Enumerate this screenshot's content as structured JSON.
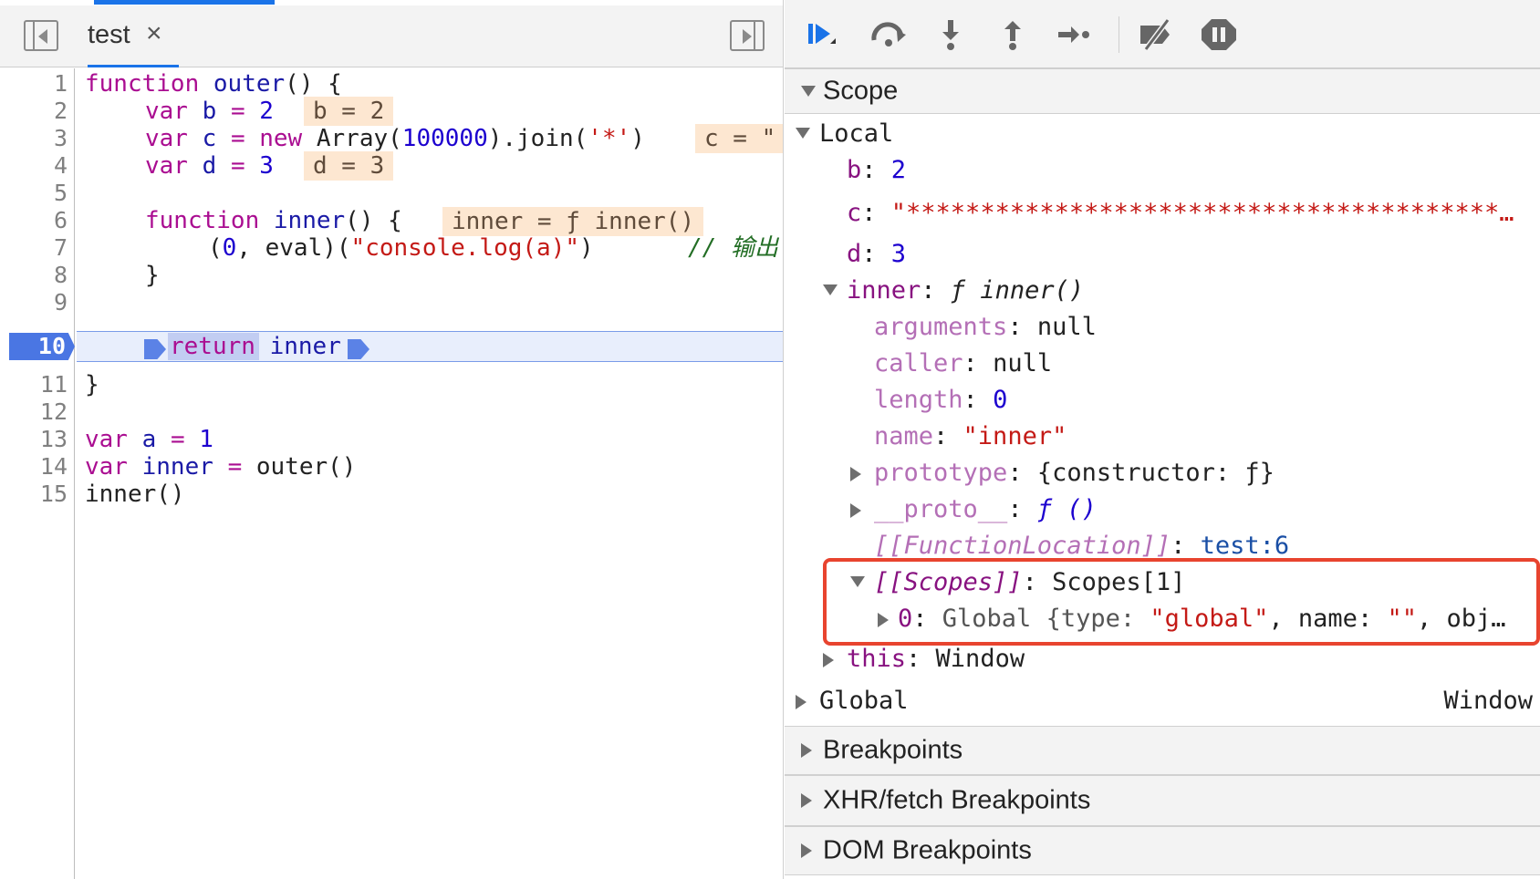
{
  "tab": {
    "file_name": "test",
    "close_glyph": "×"
  },
  "gutter": {
    "line_numbers": [
      "1",
      "2",
      "3",
      "4",
      "5",
      "6",
      "7",
      "8",
      "9",
      "10",
      "11",
      "12",
      "13",
      "14",
      "15"
    ],
    "paused_line": "10"
  },
  "code": {
    "l1": {
      "kw": "function",
      "name": "outer",
      "rest": "() {"
    },
    "l2": {
      "kw": "var",
      "name": "b",
      "eq": "=",
      "val": "2"
    },
    "l3": {
      "kw": "var",
      "name": "c",
      "eq": "=",
      "new": "new",
      "call": "Array(",
      "num": "100000",
      "join": ").join(",
      "str": "'*'",
      "end": ")"
    },
    "l4": {
      "kw": "var",
      "name": "d",
      "eq": "=",
      "val": "3"
    },
    "l6": {
      "kw": "function",
      "name": "inner",
      "rest": "() {"
    },
    "l7": {
      "open": "(",
      "zero": "0",
      "mid": ", eval)(",
      "str": "\"console.log(a)\"",
      "close": ")",
      "comment": "// 输出"
    },
    "l8": {
      "text": "}"
    },
    "l10": {
      "kw": "return",
      "name": "inner"
    },
    "l11": {
      "text": "}"
    },
    "l13": {
      "kw": "var",
      "name": "a",
      "eq": "=",
      "val": "1"
    },
    "l14": {
      "kw": "var",
      "name": "inner",
      "eq": "=",
      "call": "outer()"
    },
    "l15": {
      "call": "inner()"
    }
  },
  "inline_values": {
    "b": "b = 2",
    "c": "c = \"",
    "d": "d = 3",
    "inner": "inner = ƒ inner()"
  },
  "toolbar": {
    "resume": "resume-icon",
    "step_over": "step-over-icon",
    "step_into": "step-into-icon",
    "step_out": "step-out-icon",
    "step": "step-icon",
    "deactivate": "deactivate-breakpoints-icon",
    "pause_exceptions": "pause-on-exceptions-icon",
    "accent_color": "#1a73e8"
  },
  "scope": {
    "header": "Scope",
    "local_label": "Local",
    "b_key": "b",
    "b_val": "2",
    "c_key": "c",
    "c_val": "\"****************************************…",
    "d_key": "d",
    "d_val": "3",
    "inner_key": "inner",
    "inner_val": "ƒ inner()",
    "arguments_key": "arguments",
    "arguments_val": "null",
    "caller_key": "caller",
    "caller_val": "null",
    "length_key": "length",
    "length_val": "0",
    "name_key": "name",
    "name_val": "\"inner\"",
    "prototype_key": "prototype",
    "prototype_val": "{constructor: ƒ}",
    "proto_key": "__proto__",
    "proto_val": "ƒ ()",
    "funcloc_key": "[[FunctionLocation]]",
    "funcloc_val": "test:6",
    "scopes_key": "[[Scopes]]",
    "scopes_val": "Scopes[1]",
    "scope0_key": "0",
    "scope0_pre": "Global {type: ",
    "scope0_type": "\"global\"",
    "scope0_mid": ", name: ",
    "scope0_name": "\"\"",
    "scope0_end": ", obj…",
    "this_key": "this",
    "this_val": "Window",
    "global_label": "Global",
    "global_val": "Window"
  },
  "sections": {
    "breakpoints": "Breakpoints",
    "xhr": "XHR/fetch Breakpoints",
    "dom": "DOM Breakpoints"
  },
  "highlight_color": "#e8442f"
}
